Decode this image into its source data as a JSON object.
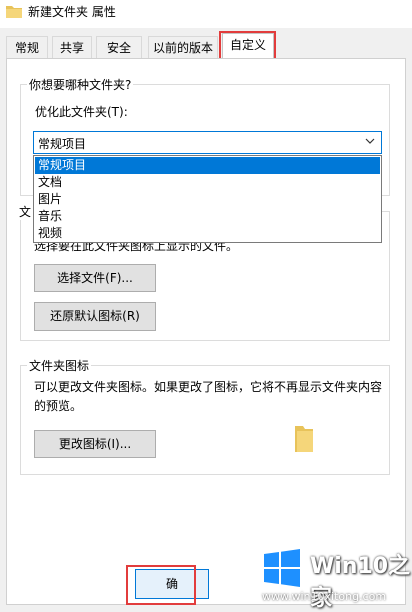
{
  "window": {
    "title": "新建文件夹 属性"
  },
  "tabs": [
    {
      "label": "常规"
    },
    {
      "label": "共享"
    },
    {
      "label": "安全"
    },
    {
      "label": "以前的版本"
    },
    {
      "label": "自定义",
      "active": true
    }
  ],
  "optimize": {
    "group_title": "你想要哪种文件夹?",
    "label": "优化此文件夹(T):",
    "selected": "常规项目",
    "options": [
      "常规项目",
      "文档",
      "图片",
      "音乐",
      "视频"
    ]
  },
  "folder_picture": {
    "title_fragment": "文",
    "hint": "选择要在此文件夹图标上显示的文件。",
    "choose_button": "选择文件(F)...",
    "restore_button": "还原默认图标(R)"
  },
  "folder_icon": {
    "group_title": "文件夹图标",
    "description": "可以更改文件夹图标。如果更改了图标，它将不再显示文件夹内容的预览。",
    "change_button": "更改图标(I)..."
  },
  "footer": {
    "ok_button_fragment": "确"
  },
  "watermark": {
    "brand": "Win10之家",
    "url": "www.win10xitong.com"
  },
  "colors": {
    "highlight_outline": "#e23c3c",
    "selection": "#0078d7",
    "folder": "#e8c35a"
  }
}
